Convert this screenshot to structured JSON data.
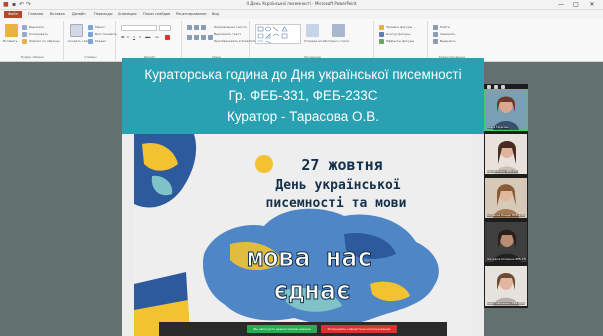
{
  "window": {
    "title": "ІІ День Української писемності - Microsoft PowerPoint",
    "minimize": "—",
    "maximize": "□",
    "close": "✕"
  },
  "ribbon": {
    "tabs": [
      "Файл",
      "Главная",
      "Вставка",
      "Дизайн",
      "Переходы",
      "Анимация",
      "Показ слайдов",
      "Рецензирование",
      "Вид"
    ],
    "groups": [
      {
        "name": "Буфер обмена",
        "items": [
          "Вставить",
          "Вырезать",
          "Копировать",
          "Формат по образцу"
        ]
      },
      {
        "name": "Слайды",
        "items": [
          "Создать слайд",
          "Макет",
          "Восстановить",
          "Раздел"
        ]
      },
      {
        "name": "Шрифт",
        "items": [
          "Ж",
          "К",
          "Ч",
          "S",
          "abc",
          "Аа"
        ]
      },
      {
        "name": "Абзац",
        "items": [
          "Направление текста",
          "Выровнять текст",
          "Преобразовать в SmartArt"
        ]
      },
      {
        "name": "Рисование",
        "items": [
          "Упорядочить",
          "Экспресс-стили"
        ]
      },
      {
        "name": "",
        "items": [
          "Заливка фигуры",
          "Контур фигуры",
          "Эффекты фигуры"
        ]
      },
      {
        "name": "Редактирование",
        "items": [
          "Найти",
          "Заменить",
          "Выделить"
        ]
      }
    ]
  },
  "slide": {
    "header_line1": "Кураторська година до Дня української писемності",
    "header_line2": "Гр. ФЕБ-331, ФЕБ-233С",
    "header_line3": "Куратор - Тарасова О.В.",
    "poster_line1": "27 жовтня",
    "poster_line2": "День української",
    "poster_line3": "писемності та мови",
    "poster_big1": "мова нас",
    "poster_big2": "єднає"
  },
  "participants": [
    {
      "name": "Ольга Тарасова",
      "active": true
    },
    {
      "name": "Сергій Білоус ФЕБ-331",
      "active": false
    },
    {
      "name": "Катерина Бондар ФЕБ-233С",
      "active": false
    },
    {
      "name": "Шкурдіна Катерина ФЕБ-331",
      "active": false
    },
    {
      "name": "Анна Гавриленко ФЕБ-233С",
      "active": false
    }
  ],
  "recording": {
    "pause_label": "Вы записуєте демонстрацію екрана",
    "stop_label": "Остановить совместное использование"
  },
  "colors": {
    "accent": "#b7472a",
    "slide_header": "#2aa0b3",
    "poster_text": "#15304a",
    "active_speaker": "#3ad16a",
    "rec_green": "#2fa84f",
    "rec_red": "#d9342b"
  }
}
